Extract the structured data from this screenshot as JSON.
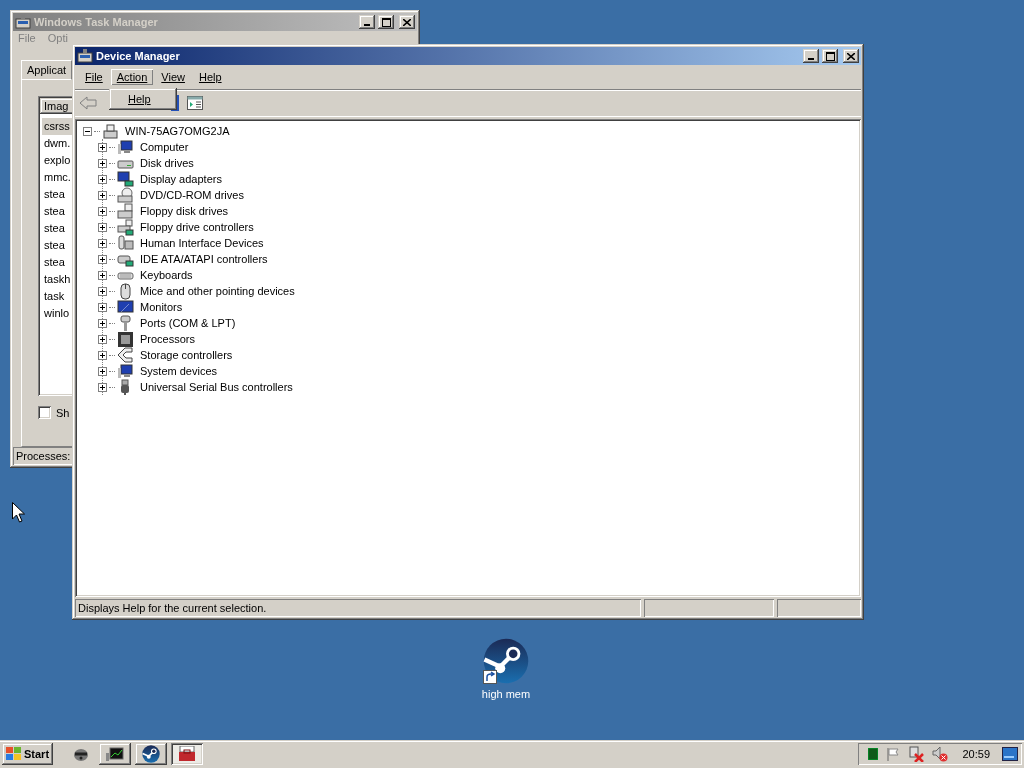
{
  "task_manager": {
    "title": "Windows Task Manager",
    "active": false,
    "menu": [
      {
        "label": "File"
      },
      {
        "label": "Opti"
      }
    ],
    "tabs": [
      {
        "label": "Applicat",
        "selected": false
      }
    ],
    "list": {
      "column": "Imag",
      "rows": [
        {
          "label": "csrss",
          "selected": true
        },
        {
          "label": "dwm.",
          "selected": false
        },
        {
          "label": "explo",
          "selected": false
        },
        {
          "label": "mmc.",
          "selected": false
        },
        {
          "label": "stea",
          "selected": false
        },
        {
          "label": "stea",
          "selected": false
        },
        {
          "label": "stea",
          "selected": false
        },
        {
          "label": "stea",
          "selected": false
        },
        {
          "label": "stea",
          "selected": false
        },
        {
          "label": "taskh",
          "selected": false
        },
        {
          "label": "task",
          "selected": false
        },
        {
          "label": "winlo",
          "selected": false
        }
      ]
    },
    "show_all": {
      "label": "Sh",
      "checked": false
    },
    "status_bar": "Processes:"
  },
  "device_manager": {
    "title": "Device Manager",
    "active": true,
    "menu": [
      {
        "label": "File",
        "selected": false
      },
      {
        "label": "Action",
        "selected": true
      },
      {
        "label": "View",
        "selected": false
      },
      {
        "label": "Help",
        "selected": false
      }
    ],
    "open_menu": {
      "items": [
        {
          "label": "Help"
        }
      ]
    },
    "tree": {
      "label": "WIN-75AG7OMG2JA",
      "expanded": true,
      "children": [
        {
          "label": "Computer",
          "expanded": false
        },
        {
          "label": "Disk drives",
          "expanded": false
        },
        {
          "label": "Display adapters",
          "expanded": false
        },
        {
          "label": "DVD/CD-ROM drives",
          "expanded": false
        },
        {
          "label": "Floppy disk drives",
          "expanded": false
        },
        {
          "label": "Floppy drive controllers",
          "expanded": false
        },
        {
          "label": "Human Interface Devices",
          "expanded": false
        },
        {
          "label": "IDE ATA/ATAPI controllers",
          "expanded": false
        },
        {
          "label": "Keyboards",
          "expanded": false
        },
        {
          "label": "Mice and other pointing devices",
          "expanded": false
        },
        {
          "label": "Monitors",
          "expanded": false
        },
        {
          "label": "Ports (COM & LPT)",
          "expanded": false
        },
        {
          "label": "Processors",
          "expanded": false
        },
        {
          "label": "Storage controllers",
          "expanded": false
        },
        {
          "label": "System devices",
          "expanded": false
        },
        {
          "label": "Universal Serial Bus controllers",
          "expanded": false
        }
      ]
    },
    "status_bar": "Displays Help for the current selection."
  },
  "desktop": {
    "icons": [
      {
        "label": "high mem"
      }
    ]
  },
  "taskbar": {
    "start": "Start",
    "buttons": [
      {
        "selected": false
      },
      {
        "selected": false
      },
      {
        "selected": true
      }
    ],
    "clock": "20:59"
  }
}
